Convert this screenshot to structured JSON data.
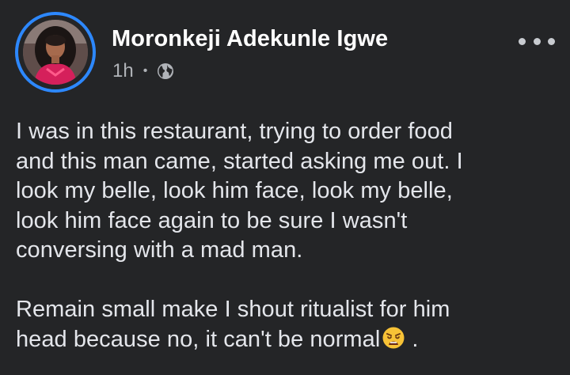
{
  "post": {
    "author": {
      "name": "Moronkeji Adekunle Igwe",
      "avatar": "avatar"
    },
    "meta": {
      "time": "1h",
      "separator": "•",
      "audience_icon": "globe-icon"
    },
    "more_icon": "more-options-icon",
    "body": {
      "paragraph_1": "I was in this restaurant, trying to order food\nand this man came, started asking me out. I\nlook my belle, look him face, look my belle,\nlook him face again to be sure I wasn't\nconversing with a mad man.",
      "paragraph_2": "Remain small make I shout ritualist for him\nhead because no, it can't be normal",
      "paragraph_2_end": " .",
      "emoji": "weary-face-emoji"
    }
  },
  "colors": {
    "background": "#242527",
    "text": "#e4e6eb",
    "secondary_text": "#b0b3b8",
    "avatar_ring": "#2d88ff"
  }
}
